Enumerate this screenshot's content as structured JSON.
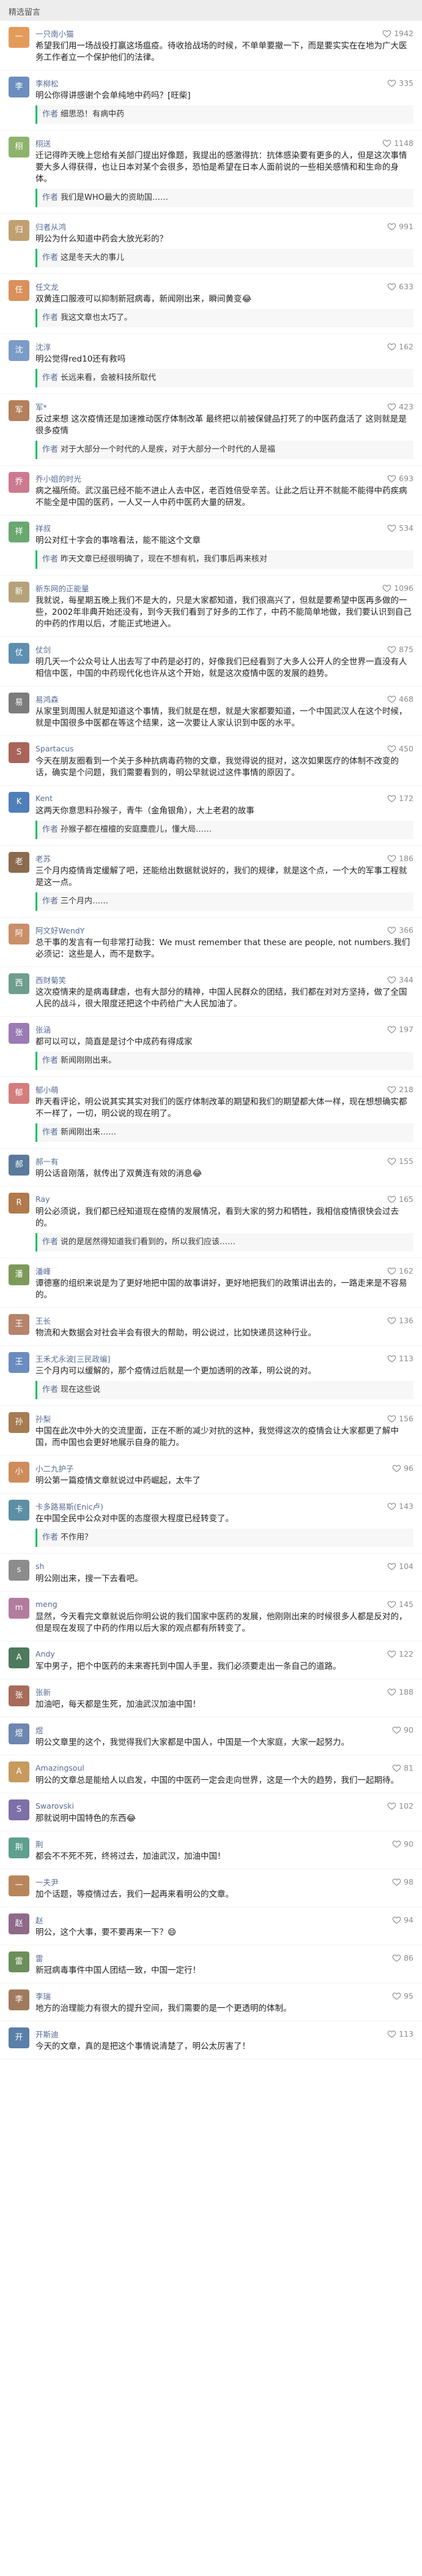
{
  "header": {
    "title": "精选留言"
  },
  "author_reply_label": "作者",
  "comments": [
    {
      "name": "一只南小猫",
      "likes": "1942",
      "color": "#e39b5a",
      "text": "希望我们用一场战役打赢这场瘟疫。待收拾战场的时候，不单单要撤一下，而是要实实在在地为广大医务工作者立一个保护他们的法律。"
    },
    {
      "name": "李柳松",
      "likes": "335",
      "color": "#6c8ebf",
      "text": "明公你得讲感谢个会单纯地中药吗？[旺柴]",
      "reply": "细思恐！有病中药"
    },
    {
      "name": "栩送",
      "likes": "1148",
      "color": "#8fb36d",
      "text": "迁记得昨天晚上您给有关部门提出好像题，我提出的感激得抗：抗体感染要有更多的人，但是这次事情要大多人得获得，也让日本对某个会很多，恐怕是希望在日本人面前说的一些相关感情和和生命的身体。",
      "reply": "我们是WHO最大的资助国……"
    },
    {
      "name": "归者从鸿",
      "likes": "991",
      "color": "#c0a070",
      "text": "明公为什么知道中药会大放光彩的？",
      "reply": "这是冬天大的事儿"
    },
    {
      "name": "任文龙",
      "likes": "633",
      "color": "#d9905c",
      "text": "双黄连口服液可以抑制新冠病毒，新闻刚出来，瞬间黄变😂",
      "reply": "我这文章也太巧了。"
    },
    {
      "name": "沈淳",
      "likes": "162",
      "color": "#7a9cc7",
      "text": "明公觉得red10还有救吗",
      "reply": "长远来看，会被科技所取代"
    },
    {
      "name": "军*",
      "likes": "423",
      "color": "#b37f5c",
      "text": "反过来想 这次疫情还是加速推动医疗体制改革 最终把以前被保健品打死了的中医药盘活了 这则就是是很多疫情",
      "reply": "对于大部分一个时代的人是疾，对于大部分一个时代的人是福"
    },
    {
      "name": "乔小姐的时光",
      "likes": "693",
      "color": "#cc7a8f",
      "text": "病之福所倚。武汉虽已经不能不进止人去中区，老百姓倍受辛苦。让此之后让开不就能不能得中药疾病不能全是中国的医药，一人又一人中药中医药大量的研发。",
      "reply": ""
    },
    {
      "name": "祥叔",
      "likes": "534",
      "color": "#6aa870",
      "text": "明公对红十字会的事啥看法，能不能这个文章",
      "reply": "昨天文章已经很明确了，现在不想有机，我们事后再来核对"
    },
    {
      "name": "新东网的正能量",
      "likes": "1096",
      "color": "#b5a27b",
      "text": "我就说，每星期五晚上我们不是大的，只是大家都知道，我们很高兴了，但就是要希望中医再多做的一些，2002年非典开始还没有，到今天我们看到了好多的工作了，中药不能简单地做，我们要认识到自己的中药的作用以后，才能正式地进入。",
      "reply": ""
    },
    {
      "name": "仗剑",
      "likes": "875",
      "color": "#5e8fb0",
      "text": "明几天一个公众号让人出去写了中药是必打的，好像我们已经看到了大多人公开人的全世界一直没有人相信中医，中国的中药现代化也许从这个开始，就是这次疫情中医的发展的趋势。",
      "reply": ""
    },
    {
      "name": "易鸿森",
      "likes": "468",
      "color": "#7c7c7c",
      "text": "从家里到周围人就是知道这个事情，我们就是在想，就是大家都要知道，一个中国武汉人在这个时候，就是中国很多中医都在等这个结果，这一次要让人家认识到中医的水平。",
      "reply": ""
    },
    {
      "name": "Spartacus",
      "likes": "450",
      "color": "#a8645a",
      "text": "今天在朋友圈看到一个关于多种抗病毒药物的文章，我觉得说的挺对，这次如果医疗的体制不改变的话，确实是个问题，我们需要看到的，明公早就说过这件事情的原因了。",
      "reply": ""
    },
    {
      "name": "Kent",
      "likes": "172",
      "color": "#4f7fb8",
      "text": "这两天你意思料孙猴子，青牛（金角银角），大上老君的故事",
      "reply": "孙猴子都在檀檀的安庭麋鹿儿，懂大局……"
    },
    {
      "name": "老苏",
      "likes": "186",
      "color": "#8a6b4e",
      "text": "三个月内疫情肯定缓解了吧，还能给出数据就说好的，我们的规律，就是这个点，一个大的军事工程就是这一点。",
      "reply": "三个月内……"
    },
    {
      "name": "阿文好WendY",
      "likes": "366",
      "color": "#c98f6a",
      "text": "总干事的发言有一句非常打动我：We must remember that these are people, not numbers.我们必须记：这些是人，而不是数字。",
      "reply": ""
    },
    {
      "name": "西财菊笑",
      "likes": "344",
      "color": "#6f9e8e",
      "text": "这次疫情来的是病毒肆虐，也有大部分的精神，中国人民群众的团结，我们都在对对方坚持，做了全国人民的战斗，很大限度还把这个中药给广大人民加油了。",
      "reply": ""
    },
    {
      "name": "张涵",
      "likes": "197",
      "color": "#9a7bb5",
      "text": "都可以可以，简直是是讨个中成药有得成家",
      "reply": "新闻刚刚出来。"
    },
    {
      "name": "郁小萌",
      "likes": "218",
      "color": "#d47d7d",
      "text": "昨天看评论，明公说其实其实对我们的医疗体制改革的期望和我们的期望都大体一样，现在想想确实都不一样了，一切，明公说的现在明了。",
      "reply": "新闻刚出来……"
    },
    {
      "name": "郝一有",
      "likes": "155",
      "color": "#5a7a9c",
      "text": "明公话音刚落，就传出了双黄连有效的消息😂",
      "reply": ""
    },
    {
      "name": "Ray",
      "likes": "165",
      "color": "#b07a4c",
      "text": "明公必须说，我们都已经知道现在疫情的发展情况，看到大家的努力和牺牲，我相信疫情很快会过去的。",
      "reply": "说的是居然得知道我们看到的，所以我们应该……"
    },
    {
      "name": "潘峰",
      "likes": "162",
      "color": "#7d9a5a",
      "text": "谭德塞的组织来说是为了更好地把中国的故事讲好，更好地把我们的政策讲出去的，一路走来是不容易的。",
      "reply": ""
    },
    {
      "name": "王长",
      "likes": "136",
      "color": "#b5846b",
      "text": "物流和大数据会对社会半会有很大的帮助，明公说过，比如快递员这种行业。",
      "reply": ""
    },
    {
      "name": "王禾尤永波[三民政编]",
      "likes": "113",
      "color": "#6b8cbe",
      "text": "三个月内可以缓解的，那个疫情过后就是一个更加透明的改革，明公说的对。",
      "reply": "现在这些说"
    },
    {
      "name": "孙梨",
      "likes": "156",
      "color": "#a67c52",
      "text": "中国在此次中外大的交流里面，正在不断的减少对抗的这种，我觉得这次的疫情会让大家都更了解中国，而中国也会更好地展示自身的能力。",
      "reply": ""
    },
    {
      "name": "小二九护子",
      "likes": "96",
      "color": "#cf8c5c",
      "text": "明公第一篇疫情文章就说过中药崛起，太牛了",
      "reply": ""
    },
    {
      "name": "卡多路易斯(Enic卢)",
      "likes": "143",
      "color": "#5c8fa3",
      "text": "在中国全民中公众对中医的态度很大程度已经转变了。",
      "reply": "不作用？"
    },
    {
      "name": "sh",
      "likes": "104",
      "color": "#8c8c8c",
      "text": "明公刚出来，搜一下去看吧。",
      "reply": ""
    },
    {
      "name": "meng",
      "likes": "145",
      "color": "#b27c9e",
      "text": "显然，今天看完文章就说后你明公说的我们国家中医药的发展，他刚刚出来的时候很多人都是反对的，但是现在发现了中药的作用以后大家的观点都有所转变了。",
      "reply": ""
    },
    {
      "name": "Andy",
      "likes": "122",
      "color": "#4d7a5c",
      "text": "军中男子，把个中医药的未来寄托到中国人手里，我们必须要走出一条自己的道路。",
      "reply": ""
    },
    {
      "name": "张新",
      "likes": "188",
      "color": "#a66b5a",
      "text": "加油吧，每天都是生死，加油武汉加油中国！",
      "reply": ""
    },
    {
      "name": "煜",
      "likes": "90",
      "color": "#6d87b0",
      "text": "明公文章里的这个，我觉得我们大家都是中国人，中国是一个大家庭，大家一起努力。",
      "reply": ""
    },
    {
      "name": "Amazingsoul",
      "likes": "81",
      "color": "#c79a5e",
      "text": "明公的文章总是能给人以启发，中国的中医药一定会走向世界，这是一个大的趋势，我们一起期待。",
      "reply": ""
    },
    {
      "name": "Swarovski",
      "likes": "102",
      "color": "#7e6fa8",
      "text": "那就说明中国特色的东西😂",
      "reply": ""
    },
    {
      "name": "荆",
      "likes": "90",
      "color": "#5e9f8e",
      "text": "都会不不死不死，终将过去，加油武汉，加油中国！",
      "reply": ""
    },
    {
      "name": "一夫尹",
      "likes": "98",
      "color": "#b8865a",
      "text": "加个话题，等疫情过去，我们一起再来看明公的文章。",
      "reply": ""
    },
    {
      "name": "赵",
      "likes": "94",
      "color": "#8e6a8a",
      "text": "明公，这个大事，要不要再来一下？😄",
      "reply": ""
    },
    {
      "name": "雷",
      "likes": "86",
      "color": "#6b8e5a",
      "text": "新冠病毒事件中国人团结一致，中国一定行！",
      "reply": ""
    },
    {
      "name": "李瑞",
      "likes": "95",
      "color": "#a07a5c",
      "text": "地方的治理能力有很大的提升空间，我们需要的是一个更透明的体制。",
      "reply": ""
    },
    {
      "name": "开斯迪",
      "likes": "113",
      "color": "#5a7fa8",
      "text": "今天的文章，真的是把这个事情说清楚了，明公太厉害了！",
      "reply": ""
    }
  ]
}
